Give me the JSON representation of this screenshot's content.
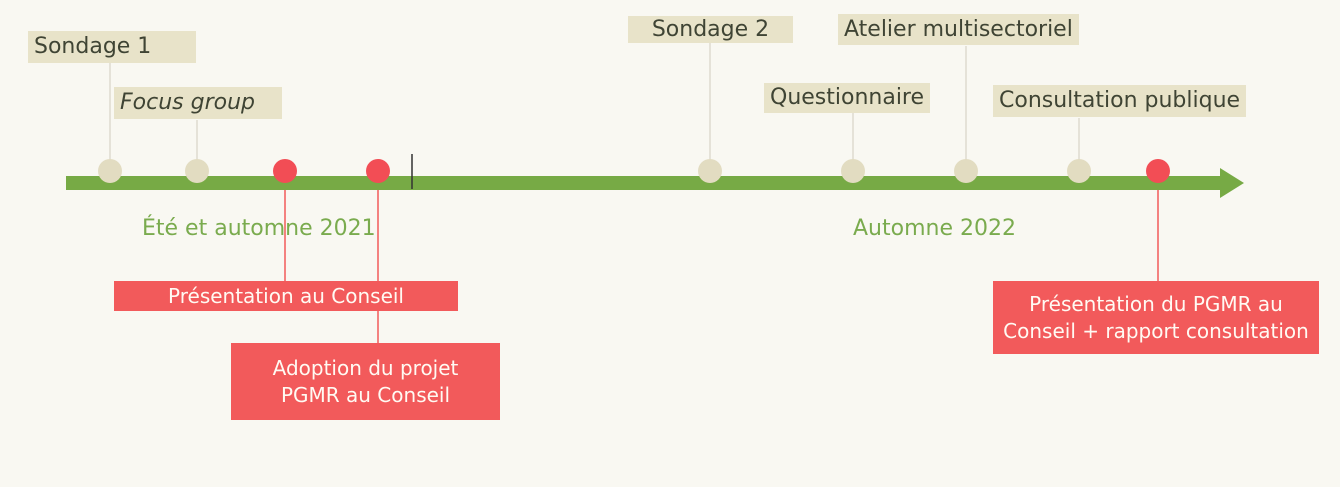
{
  "colors": {
    "background": "#f9f8f2",
    "axis": "#77aa45",
    "beige_box": "#e8e3c9",
    "beige_marker": "#e2dcc1",
    "red_box": "#f25a5b",
    "red_marker": "#f24d55",
    "period_text": "#7aab4e"
  },
  "periods": [
    "Été et automne 2021",
    "Automne 2022"
  ],
  "events_top": [
    "Sondage 1",
    "Focus group",
    "Sondage 2",
    "Questionnaire",
    "Atelier multisectoriel",
    "Consultation publique"
  ],
  "events_bottom": [
    "Présentation au Conseil",
    "Adoption du projet\nPGMR au Conseil",
    "Présentation du PGMR au\nConseil + rapport consultation"
  ]
}
